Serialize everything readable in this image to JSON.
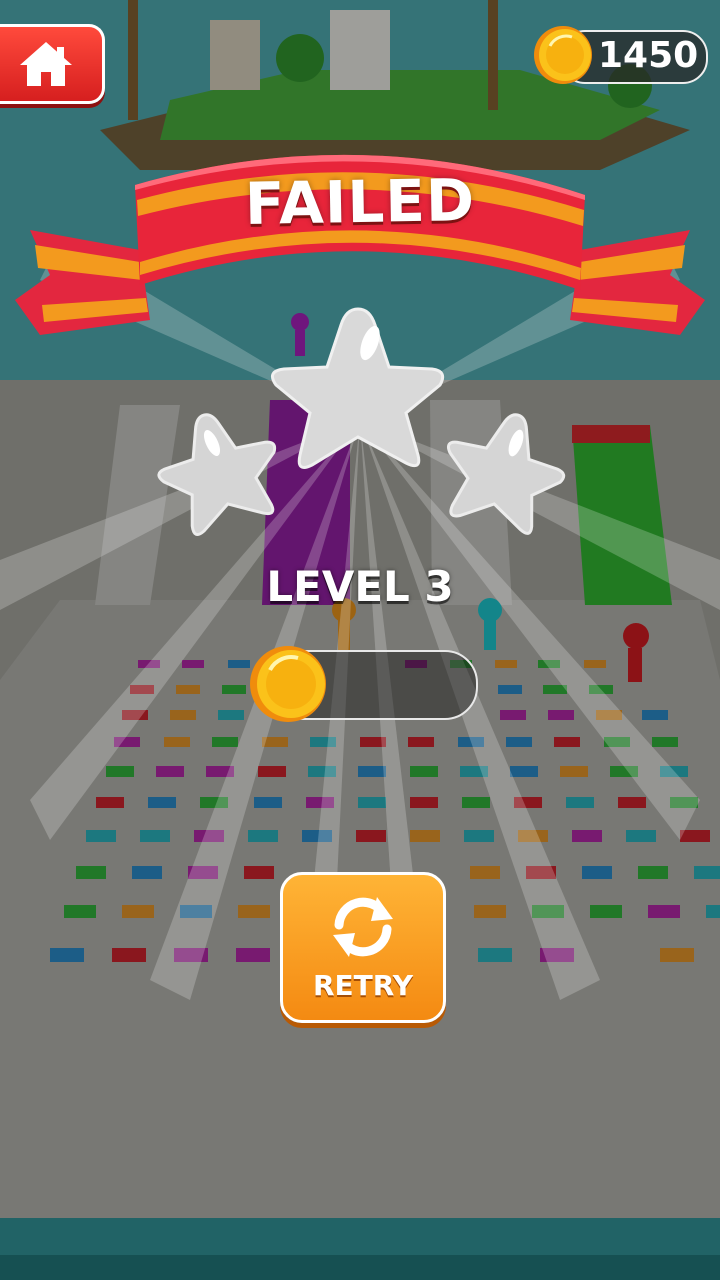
{
  "header": {
    "home_icon": "home-icon",
    "coin_icon": "coin-icon",
    "coins": "1450"
  },
  "result": {
    "title": "FAILED",
    "stars_earned": 0,
    "stars_total": 3
  },
  "level": {
    "label": "LEVEL 3",
    "progress_fraction": 0
  },
  "actions": {
    "retry_label": "RETRY",
    "retry_icon": "refresh-icon"
  },
  "colors": {
    "banner_red": "#e8253a",
    "banner_ribbon_orange": "#f39a1e",
    "home_red": "#e8322a",
    "retry_orange": "#f7a125",
    "coin_gold": "#f8c41a",
    "star_grey": "#d9d9d9"
  }
}
